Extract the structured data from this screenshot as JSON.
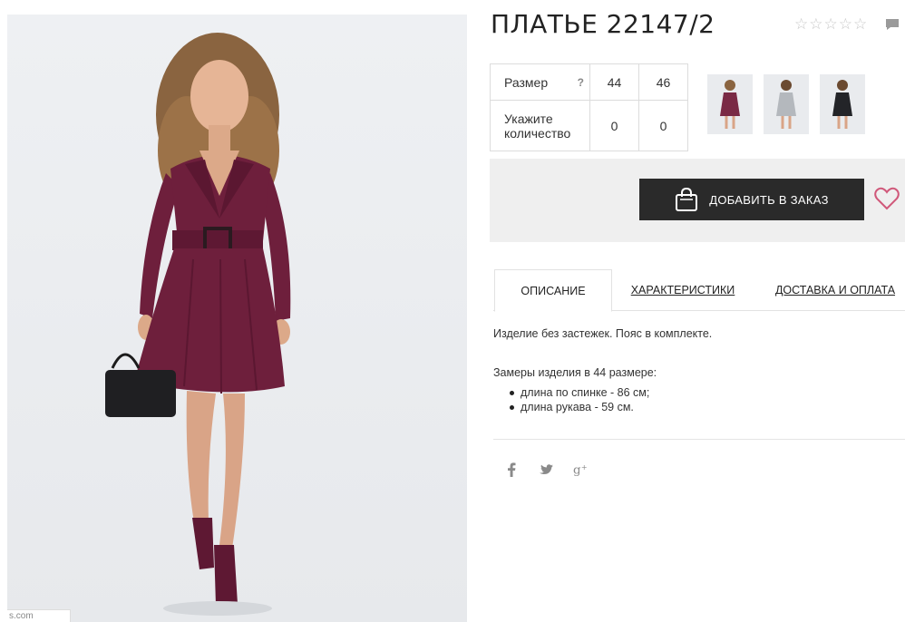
{
  "product": {
    "title": "ПЛАТЬЕ 22147/2",
    "rating_stars": 5,
    "rating_value": 0,
    "watermark": "s.com"
  },
  "sizes": {
    "size_label": "Размер",
    "help_mark": "?",
    "qty_label": "Укажите количество",
    "columns": [
      "44",
      "46"
    ],
    "quantities": [
      "0",
      "0"
    ]
  },
  "thumbnails": [
    {
      "name": "thumb-burgundy",
      "color": "#7a2a45"
    },
    {
      "name": "thumb-grey",
      "color": "#b4b8bd"
    },
    {
      "name": "thumb-black",
      "color": "#232428"
    }
  ],
  "order": {
    "button_label": "ДОБАВИТЬ В ЗАКАЗ",
    "button_icon": "shopping-bag-icon",
    "wishlist_icon": "heart-icon"
  },
  "tabs": [
    {
      "label": "ОПИСАНИЕ",
      "active": true
    },
    {
      "label": "ХАРАКТЕРИСТИКИ",
      "active": false
    },
    {
      "label": "ДОСТАВКА И ОПЛАТА",
      "active": false
    }
  ],
  "description": {
    "text": "Изделие без застежек. Пояс в комплекте.",
    "measures_title": "Замеры изделия в 44 размере:",
    "measures": [
      "длина по спинке - 86 см;",
      "длина рукава - 59 см."
    ]
  },
  "social": [
    "facebook-icon",
    "twitter-icon",
    "google-plus-icon"
  ],
  "colors": {
    "dress": "#6e1f3c",
    "button_bg": "#2a2a2a",
    "order_bar_bg": "#efefef",
    "heart": "#d0587a"
  }
}
